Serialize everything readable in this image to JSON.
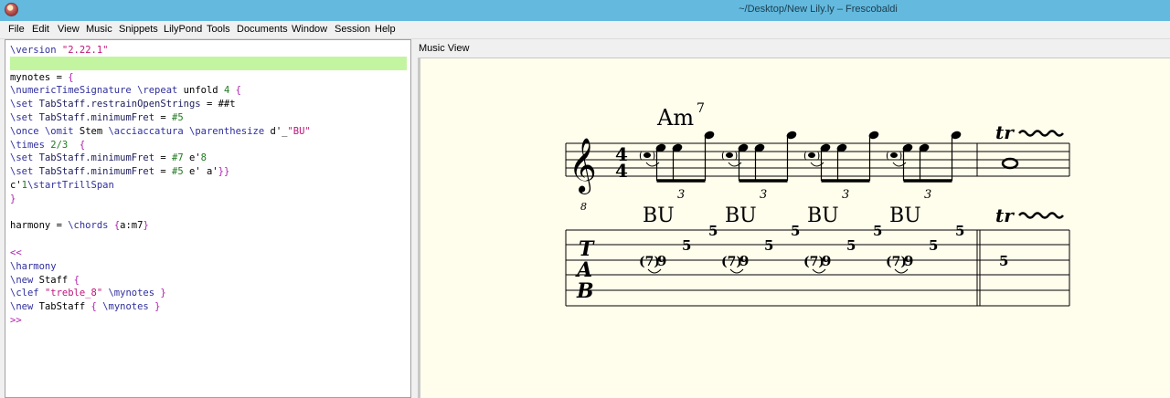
{
  "window": {
    "title": "~/Desktop/New Lily.ly – Frescobaldi"
  },
  "menubar": {
    "items": [
      "File",
      "Edit",
      "View",
      "Music",
      "Snippets",
      "LilyPond",
      "Tools",
      "Documents",
      "Window",
      "Session",
      "Help"
    ]
  },
  "editor": {
    "lines": [
      "\\version \"2.22.1\"",
      "",
      "mynotes = {",
      "\\numericTimeSignature \\repeat unfold 4 {",
      "\\set TabStaff.restrainOpenStrings = ##t",
      "\\set TabStaff.minimumFret = #5",
      "\\once \\omit Stem \\acciaccatura \\parenthesize d'_\"BU\"",
      "\\times 2/3  {",
      "\\set TabStaff.minimumFret = #7 e'8",
      "\\set TabStaff.minimumFret = #5 e' a'}}",
      "c'1\\startTrillSpan",
      "}",
      "",
      "harmony = \\chords {a:m7}",
      "",
      "<<",
      "\\harmony",
      "\\new Staff {",
      "\\clef \"treble_8\" \\mynotes }",
      "\\new TabStaff { \\mynotes }",
      ">>"
    ]
  },
  "music_view": {
    "label": "Music View",
    "score": {
      "chord_name": "Am",
      "chord_superscript": "7",
      "time_signature_top": "4",
      "time_signature_bottom": "4",
      "clef_octave": "8",
      "trill_symbol": "tr",
      "tuplet_number": "3",
      "bend_text": "BU",
      "tab_clef": [
        "T",
        "A",
        "B"
      ],
      "tab_grace": "(7)",
      "tab_frets": [
        "9",
        "5",
        "5"
      ],
      "tab_measure2_fret": "5"
    }
  }
}
